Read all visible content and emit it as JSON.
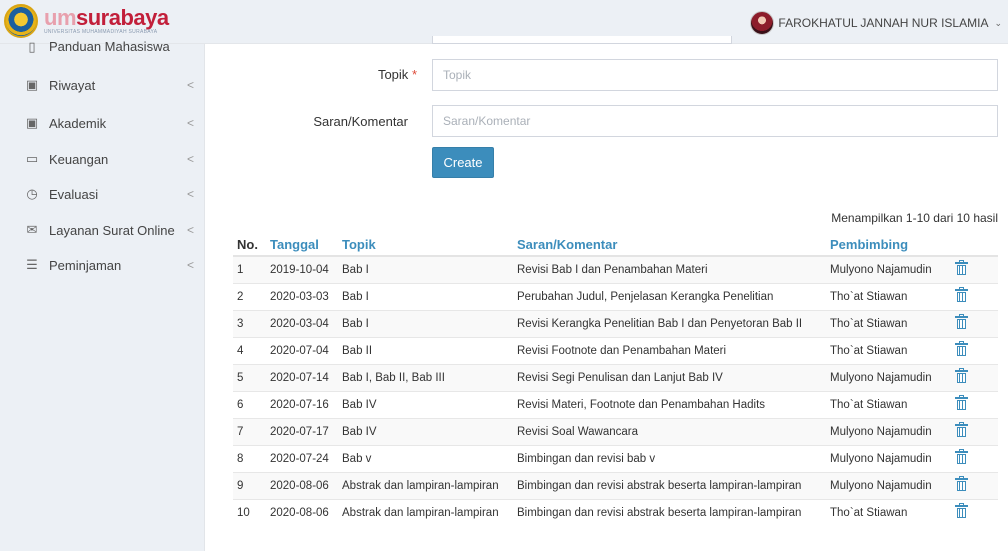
{
  "header": {
    "brand_um": "um",
    "brand_name": "surabaya",
    "brand_sub": "UNIVERSITAS MUHAMMADIYAH SURABAYA",
    "user_name": "FAROKHATUL JANNAH NUR ISLAMIA",
    "colors": {
      "topbar": "#ecf0f5",
      "brand": "#c21f3a",
      "accent": "#3c8dbc"
    }
  },
  "sidebar": {
    "items": [
      {
        "label": "Panduan Mahasiswa",
        "icon": "book-icon",
        "glyph": "▯",
        "chevron": ""
      },
      {
        "label": "Riwayat",
        "icon": "briefcase-icon",
        "glyph": "▣",
        "chevron": "<"
      },
      {
        "label": "Akademik",
        "icon": "briefcase-icon",
        "glyph": "▣",
        "chevron": "<"
      },
      {
        "label": "Keuangan",
        "icon": "folder-icon",
        "glyph": "▭",
        "chevron": "<"
      },
      {
        "label": "Evaluasi",
        "icon": "gauge-icon",
        "glyph": "◷",
        "chevron": "<"
      },
      {
        "label": "Layanan Surat Online",
        "icon": "envelope-icon",
        "glyph": "✉",
        "chevron": "<"
      },
      {
        "label": "Peminjaman",
        "icon": "list-icon",
        "glyph": "☰",
        "chevron": "<"
      }
    ]
  },
  "form": {
    "topik_label": "Topik",
    "required_mark": "*",
    "topik_placeholder": "Topik",
    "saran_label": "Saran/Komentar",
    "saran_placeholder": "Saran/Komentar",
    "create_label": "Create"
  },
  "table": {
    "summary": "Menampilkan 1-10 dari 10 hasil",
    "headers": {
      "no": "No.",
      "tanggal": "Tanggal",
      "topik": "Topik",
      "saran": "Saran/Komentar",
      "pembimbing": "Pembimbing"
    },
    "rows": [
      {
        "no": "1",
        "tanggal": "2019-10-04",
        "topik": "Bab I",
        "saran": "Revisi Bab I dan Penambahan Materi",
        "pembimbing": "Mulyono Najamudin"
      },
      {
        "no": "2",
        "tanggal": "2020-03-03",
        "topik": "Bab I",
        "saran": "Perubahan Judul, Penjelasan Kerangka Penelitian",
        "pembimbing": "Tho`at Stiawan"
      },
      {
        "no": "3",
        "tanggal": "2020-03-04",
        "topik": "Bab I",
        "saran": "Revisi Kerangka Penelitian Bab I dan Penyetoran Bab II",
        "pembimbing": "Tho`at Stiawan"
      },
      {
        "no": "4",
        "tanggal": "2020-07-04",
        "topik": "Bab II",
        "saran": "Revisi Footnote dan Penambahan Materi",
        "pembimbing": "Tho`at Stiawan"
      },
      {
        "no": "5",
        "tanggal": "2020-07-14",
        "topik": "Bab I, Bab II, Bab III",
        "saran": "Revisi Segi Penulisan dan Lanjut Bab IV",
        "pembimbing": "Mulyono Najamudin"
      },
      {
        "no": "6",
        "tanggal": "2020-07-16",
        "topik": "Bab IV",
        "saran": "Revisi Materi, Footnote dan Penambahan Hadits",
        "pembimbing": "Tho`at Stiawan"
      },
      {
        "no": "7",
        "tanggal": "2020-07-17",
        "topik": "Bab IV",
        "saran": "Revisi Soal Wawancara",
        "pembimbing": "Mulyono Najamudin"
      },
      {
        "no": "8",
        "tanggal": "2020-07-24",
        "topik": "Bab v",
        "saran": "Bimbingan dan revisi bab v",
        "pembimbing": "Mulyono Najamudin"
      },
      {
        "no": "9",
        "tanggal": "2020-08-06",
        "topik": "Abstrak dan lampiran-lampiran",
        "saran": "Bimbingan dan revisi abstrak beserta lampiran-lampiran",
        "pembimbing": "Mulyono Najamudin"
      },
      {
        "no": "10",
        "tanggal": "2020-08-06",
        "topik": "Abstrak dan lampiran-lampiran",
        "saran": "Bimbingan dan revisi abstrak beserta lampiran-lampiran",
        "pembimbing": "Tho`at Stiawan"
      }
    ],
    "action_icon": "trash-icon"
  }
}
